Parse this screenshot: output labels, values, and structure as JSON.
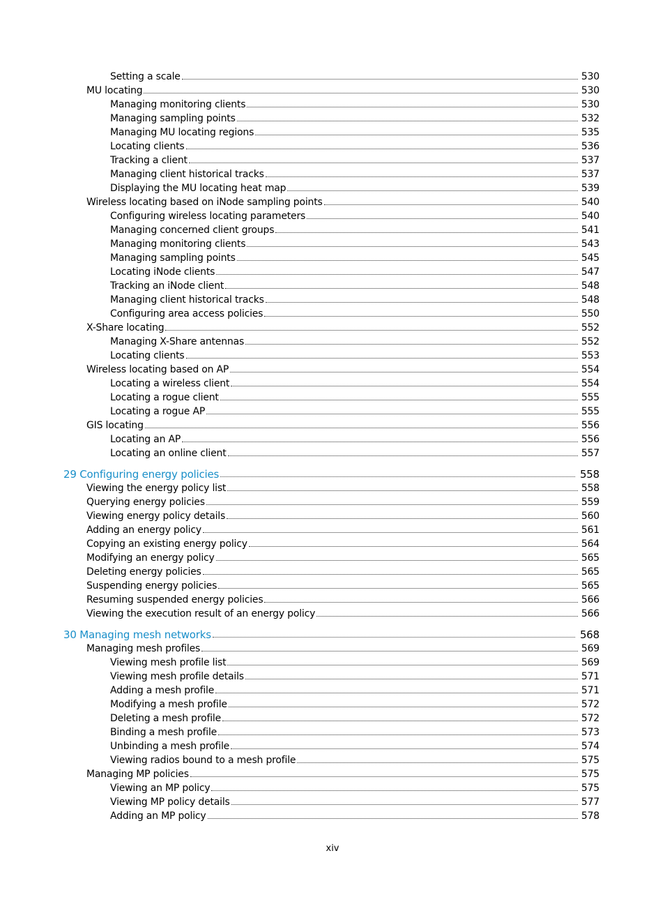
{
  "toc": [
    {
      "level": 2,
      "title": "Setting a scale",
      "page": "530"
    },
    {
      "level": 1,
      "title": "MU locating",
      "page": "530"
    },
    {
      "level": 2,
      "title": "Managing monitoring clients",
      "page": "530"
    },
    {
      "level": 2,
      "title": "Managing sampling points",
      "page": "532"
    },
    {
      "level": 2,
      "title": "Managing MU locating regions",
      "page": "535"
    },
    {
      "level": 2,
      "title": "Locating clients",
      "page": "536"
    },
    {
      "level": 2,
      "title": "Tracking a client",
      "page": "537"
    },
    {
      "level": 2,
      "title": "Managing client historical tracks",
      "page": "537"
    },
    {
      "level": 2,
      "title": "Displaying the MU locating heat map",
      "page": "539"
    },
    {
      "level": 1,
      "title": "Wireless locating based on iNode sampling points",
      "page": "540"
    },
    {
      "level": 2,
      "title": "Configuring wireless locating parameters",
      "page": "540"
    },
    {
      "level": 2,
      "title": "Managing concerned client groups",
      "page": "541"
    },
    {
      "level": 2,
      "title": "Managing monitoring clients",
      "page": "543"
    },
    {
      "level": 2,
      "title": "Managing sampling points",
      "page": "545"
    },
    {
      "level": 2,
      "title": "Locating iNode clients",
      "page": "547"
    },
    {
      "level": 2,
      "title": "Tracking an iNode client",
      "page": "548"
    },
    {
      "level": 2,
      "title": "Managing client historical tracks",
      "page": "548"
    },
    {
      "level": 2,
      "title": "Configuring area access policies",
      "page": "550"
    },
    {
      "level": 1,
      "title": "X-Share locating",
      "page": "552"
    },
    {
      "level": 2,
      "title": "Managing X-Share antennas",
      "page": "552"
    },
    {
      "level": 2,
      "title": "Locating clients",
      "page": "553"
    },
    {
      "level": 1,
      "title": "Wireless locating based on AP",
      "page": "554"
    },
    {
      "level": 2,
      "title": "Locating a wireless client",
      "page": "554"
    },
    {
      "level": 2,
      "title": "Locating a rogue client",
      "page": "555"
    },
    {
      "level": 2,
      "title": "Locating a rogue AP",
      "page": "555"
    },
    {
      "level": 1,
      "title": "GIS locating",
      "page": "556"
    },
    {
      "level": 2,
      "title": "Locating an AP",
      "page": "556"
    },
    {
      "level": 2,
      "title": "Locating an online client",
      "page": "557"
    },
    {
      "level": 0,
      "title": "29 Configuring energy policies",
      "page": "558"
    },
    {
      "level": 1,
      "title": "Viewing the energy policy list",
      "page": "558"
    },
    {
      "level": 1,
      "title": "Querying energy policies",
      "page": "559"
    },
    {
      "level": 1,
      "title": "Viewing energy policy details",
      "page": "560"
    },
    {
      "level": 1,
      "title": "Adding an energy policy",
      "page": "561"
    },
    {
      "level": 1,
      "title": "Copying an existing energy policy",
      "page": "564"
    },
    {
      "level": 1,
      "title": "Modifying an energy policy",
      "page": "565"
    },
    {
      "level": 1,
      "title": "Deleting energy policies",
      "page": "565"
    },
    {
      "level": 1,
      "title": "Suspending energy policies",
      "page": "565"
    },
    {
      "level": 1,
      "title": "Resuming suspended energy policies",
      "page": "566"
    },
    {
      "level": 1,
      "title": "Viewing the execution result of an energy policy",
      "page": "566"
    },
    {
      "level": 0,
      "title": "30 Managing mesh networks",
      "page": "568"
    },
    {
      "level": 1,
      "title": "Managing mesh profiles",
      "page": "569"
    },
    {
      "level": 2,
      "title": "Viewing mesh profile list",
      "page": "569"
    },
    {
      "level": 2,
      "title": "Viewing mesh profile details",
      "page": "571"
    },
    {
      "level": 2,
      "title": "Adding a mesh profile",
      "page": "571"
    },
    {
      "level": 2,
      "title": "Modifying a mesh profile",
      "page": "572"
    },
    {
      "level": 2,
      "title": "Deleting a mesh profile",
      "page": "572"
    },
    {
      "level": 2,
      "title": "Binding a mesh profile",
      "page": "573"
    },
    {
      "level": 2,
      "title": "Unbinding a mesh profile",
      "page": "574"
    },
    {
      "level": 2,
      "title": "Viewing radios bound to a mesh profile",
      "page": "575"
    },
    {
      "level": 1,
      "title": "Managing MP policies",
      "page": "575"
    },
    {
      "level": 2,
      "title": "Viewing an MP policy",
      "page": "575"
    },
    {
      "level": 2,
      "title": "Viewing MP policy details",
      "page": "577"
    },
    {
      "level": 2,
      "title": "Adding an MP policy",
      "page": "578"
    }
  ],
  "colors": {
    "chapter": "#1a8fc9",
    "text": "#000000"
  },
  "footer": {
    "page_number": "xiv"
  }
}
